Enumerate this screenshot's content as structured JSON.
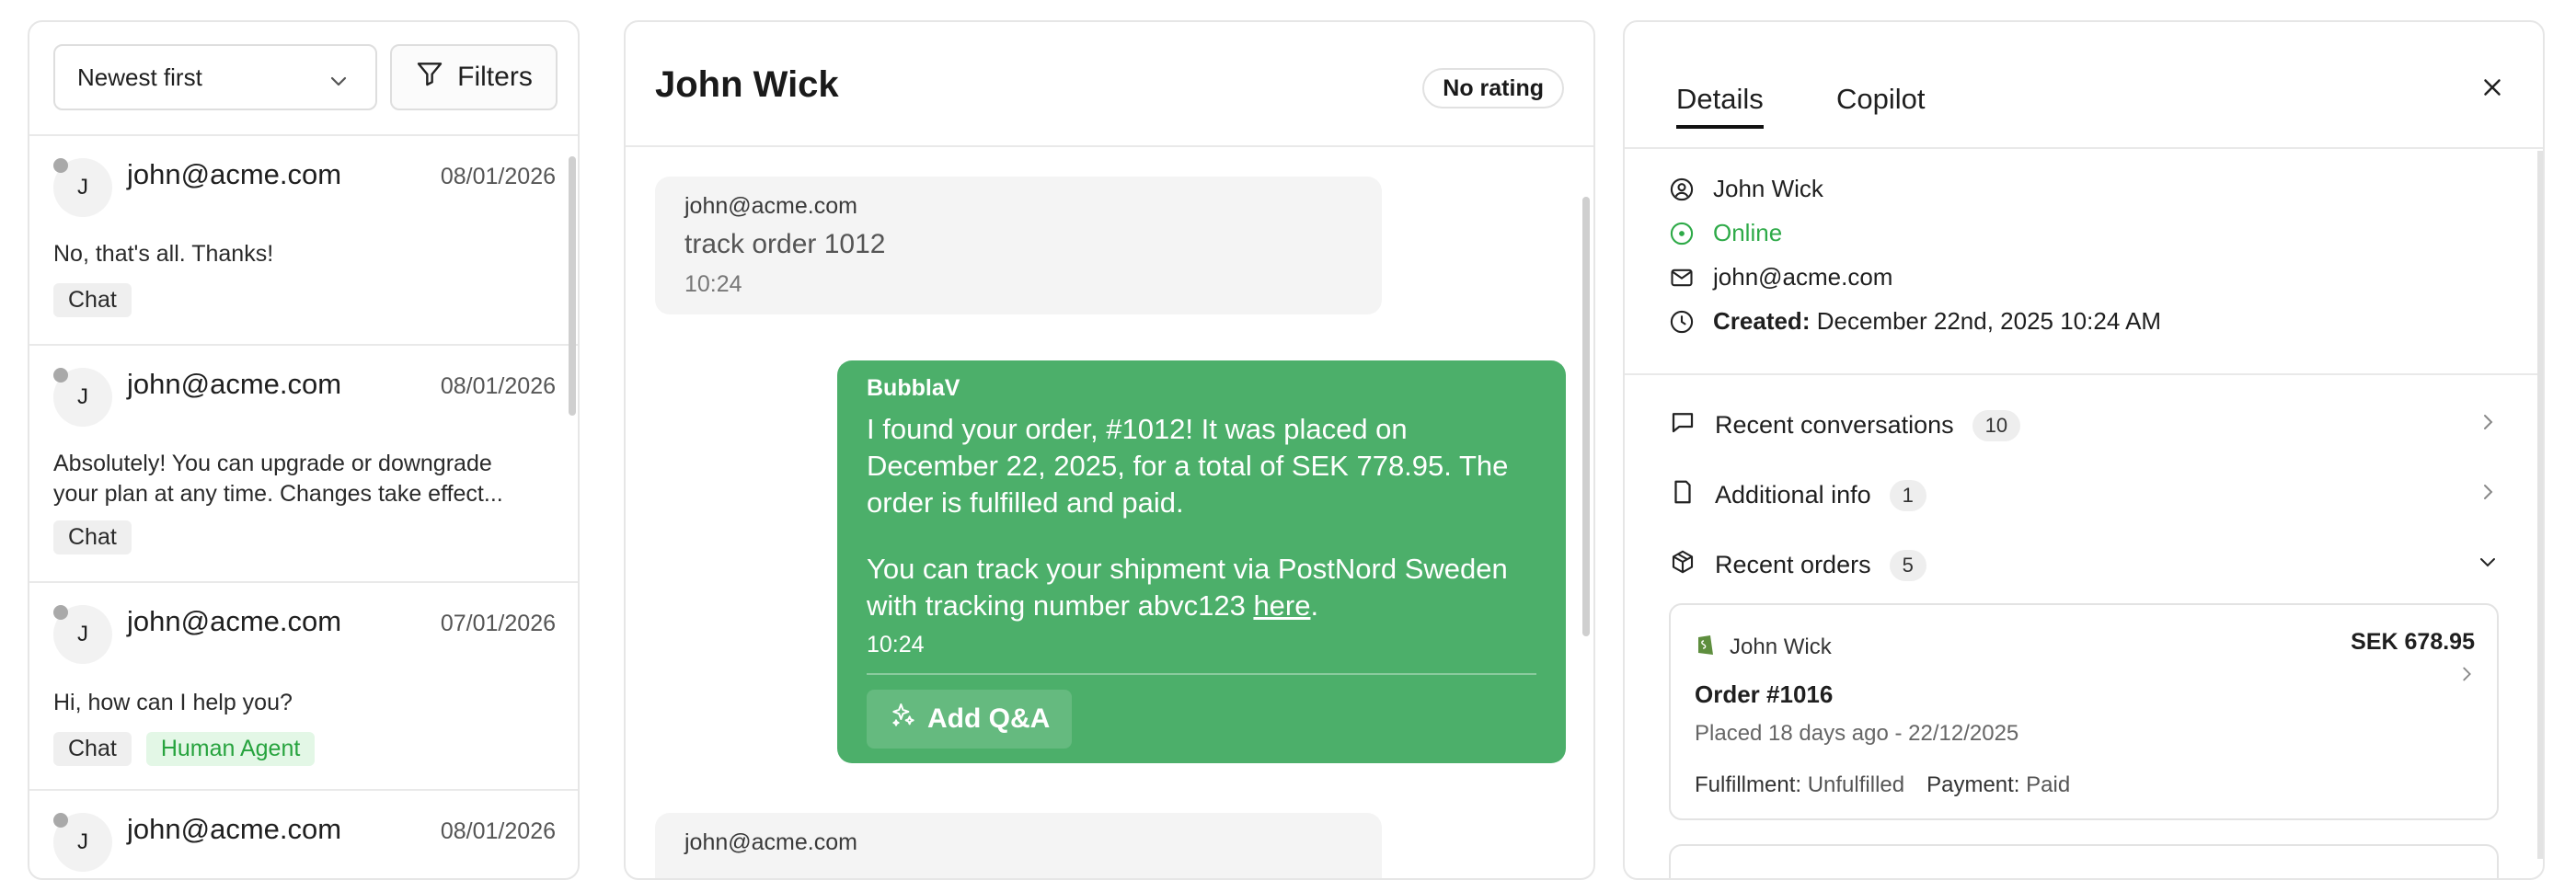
{
  "left": {
    "sort": {
      "value": "Newest first"
    },
    "filters_label": "Filters",
    "conversations": [
      {
        "avatar": "J",
        "email": "john@acme.com",
        "date": "08/01/2026",
        "message": "No, that's all. Thanks!",
        "tags": [
          "Chat"
        ]
      },
      {
        "avatar": "J",
        "email": "john@acme.com",
        "date": "08/01/2026",
        "message": "Absolutely! You can upgrade or downgrade your plan at any time. Changes take effect...",
        "tags": [
          "Chat"
        ]
      },
      {
        "avatar": "J",
        "email": "john@acme.com",
        "date": "07/01/2026",
        "message": "Hi, how can I help you?",
        "tags": [
          "Chat"
        ],
        "green_tag": "Human Agent"
      },
      {
        "avatar": "J",
        "email": "john@acme.com",
        "date": "08/01/2026"
      }
    ]
  },
  "chat": {
    "title": "John Wick",
    "rating": "No rating",
    "messages": [
      {
        "sender": "john@acme.com",
        "text": "track order 1012",
        "time": "10:24"
      },
      {
        "sender": "BubblaV",
        "paragraph1": "I found your order, #1012! It was placed on December 22, 2025, for a total of SEK 778.95. The order is fulfilled and paid.",
        "paragraph2_prefix": "You can track your shipment via PostNord Sweden with tracking number abvc123 ",
        "link_text": "here",
        "paragraph2_suffix": ".",
        "time": "10:24",
        "action_label": "Add Q&A"
      },
      {
        "sender": "john@acme.com"
      }
    ]
  },
  "details": {
    "tabs": [
      "Details",
      "Copilot"
    ],
    "active_tab": "Details",
    "name": "John Wick",
    "status": "Online",
    "email": "john@acme.com",
    "created_label": "Created:",
    "created_value": "December 22nd, 2025 10:24 AM",
    "sections": [
      {
        "label": "Recent conversations",
        "count": "10"
      },
      {
        "label": "Additional info",
        "count": "1"
      },
      {
        "label": "Recent orders",
        "count": "5"
      }
    ],
    "order": {
      "customer": "John Wick",
      "total": "SEK 678.95",
      "number": "Order #1016",
      "placed": "Placed 18 days ago - 22/12/2025",
      "fulfillment_label": "Fulfillment:",
      "fulfillment_value": "Unfulfilled",
      "payment_label": "Payment:",
      "payment_value": "Paid"
    }
  },
  "colors": {
    "accent_green": "#4caf6a",
    "online_green": "#2eaa48",
    "tag_green_bg": "#e3f7e6"
  }
}
